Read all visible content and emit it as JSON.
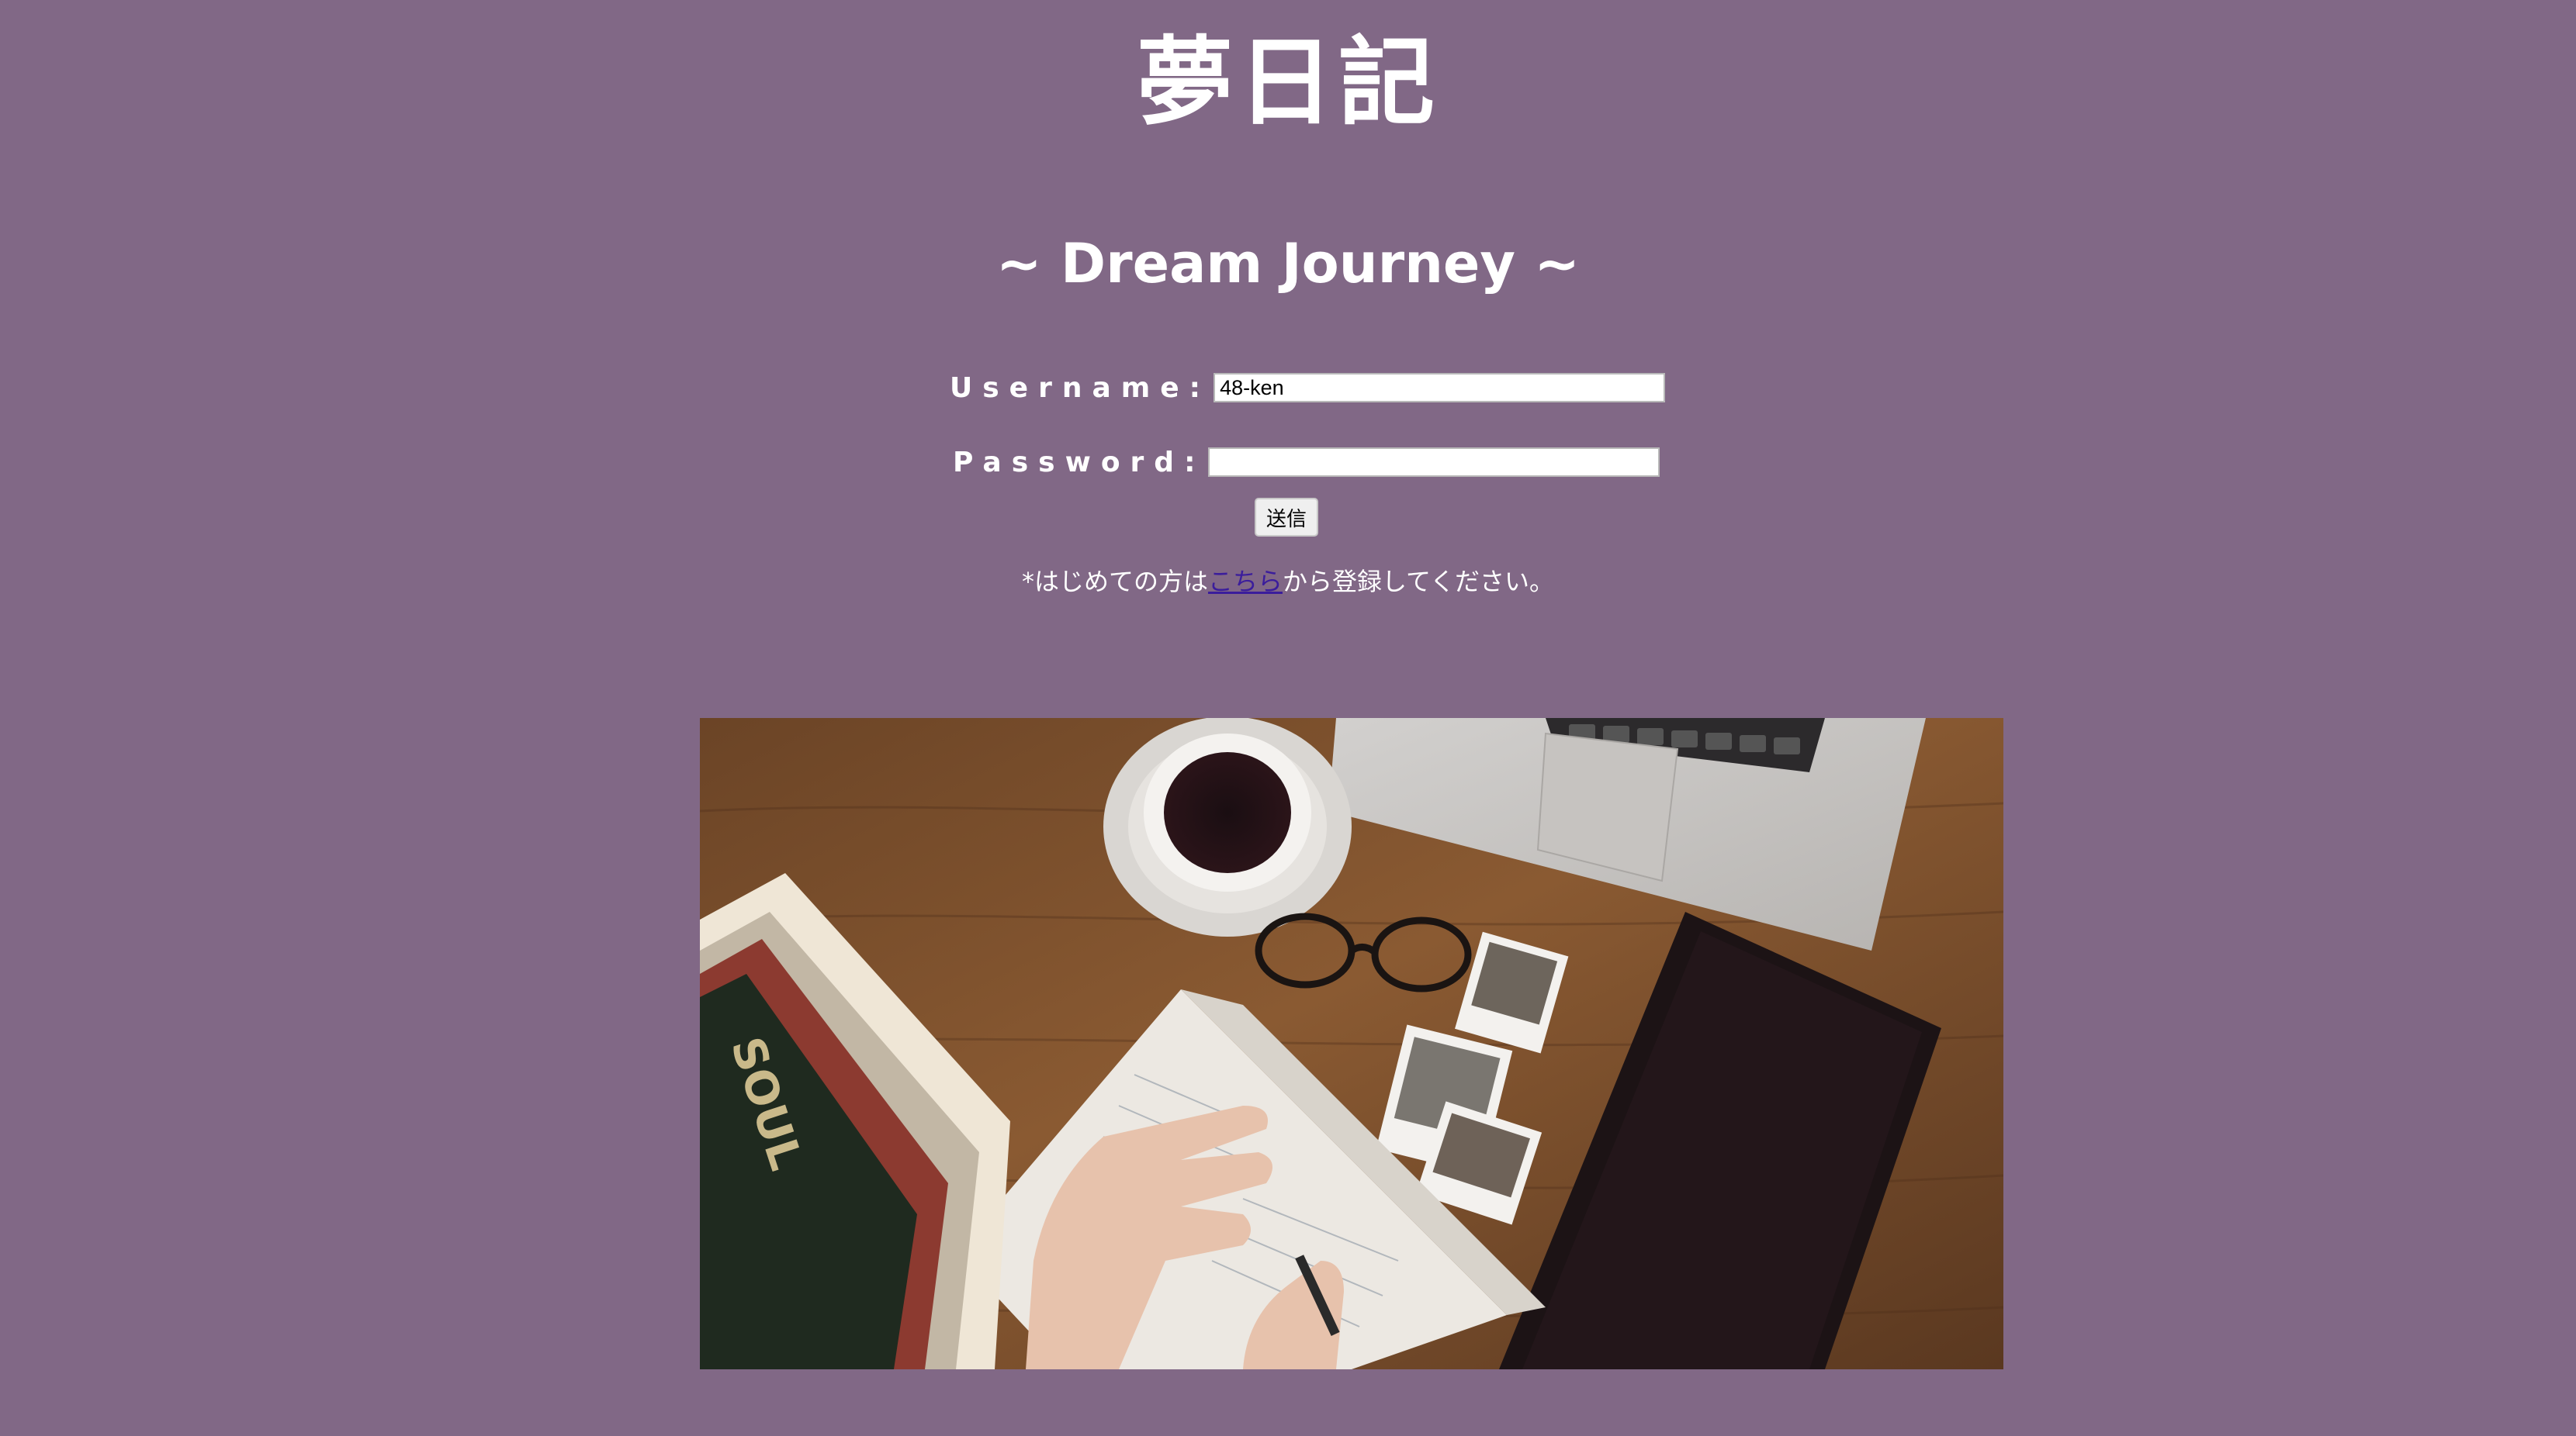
{
  "header": {
    "title": "夢日記",
    "subtitle": "~ Dream Journey ~"
  },
  "login_form": {
    "username_label": "Username:",
    "username_value": "48-ken",
    "password_label": "Password:",
    "password_value": "",
    "submit_label": "送信"
  },
  "register_note": {
    "prefix": "*はじめての方は",
    "link_text": "こちら",
    "suffix": "から登録してください。"
  },
  "colors": {
    "background": "#816886",
    "text": "#ffffff",
    "link": "#3b1d9c"
  }
}
